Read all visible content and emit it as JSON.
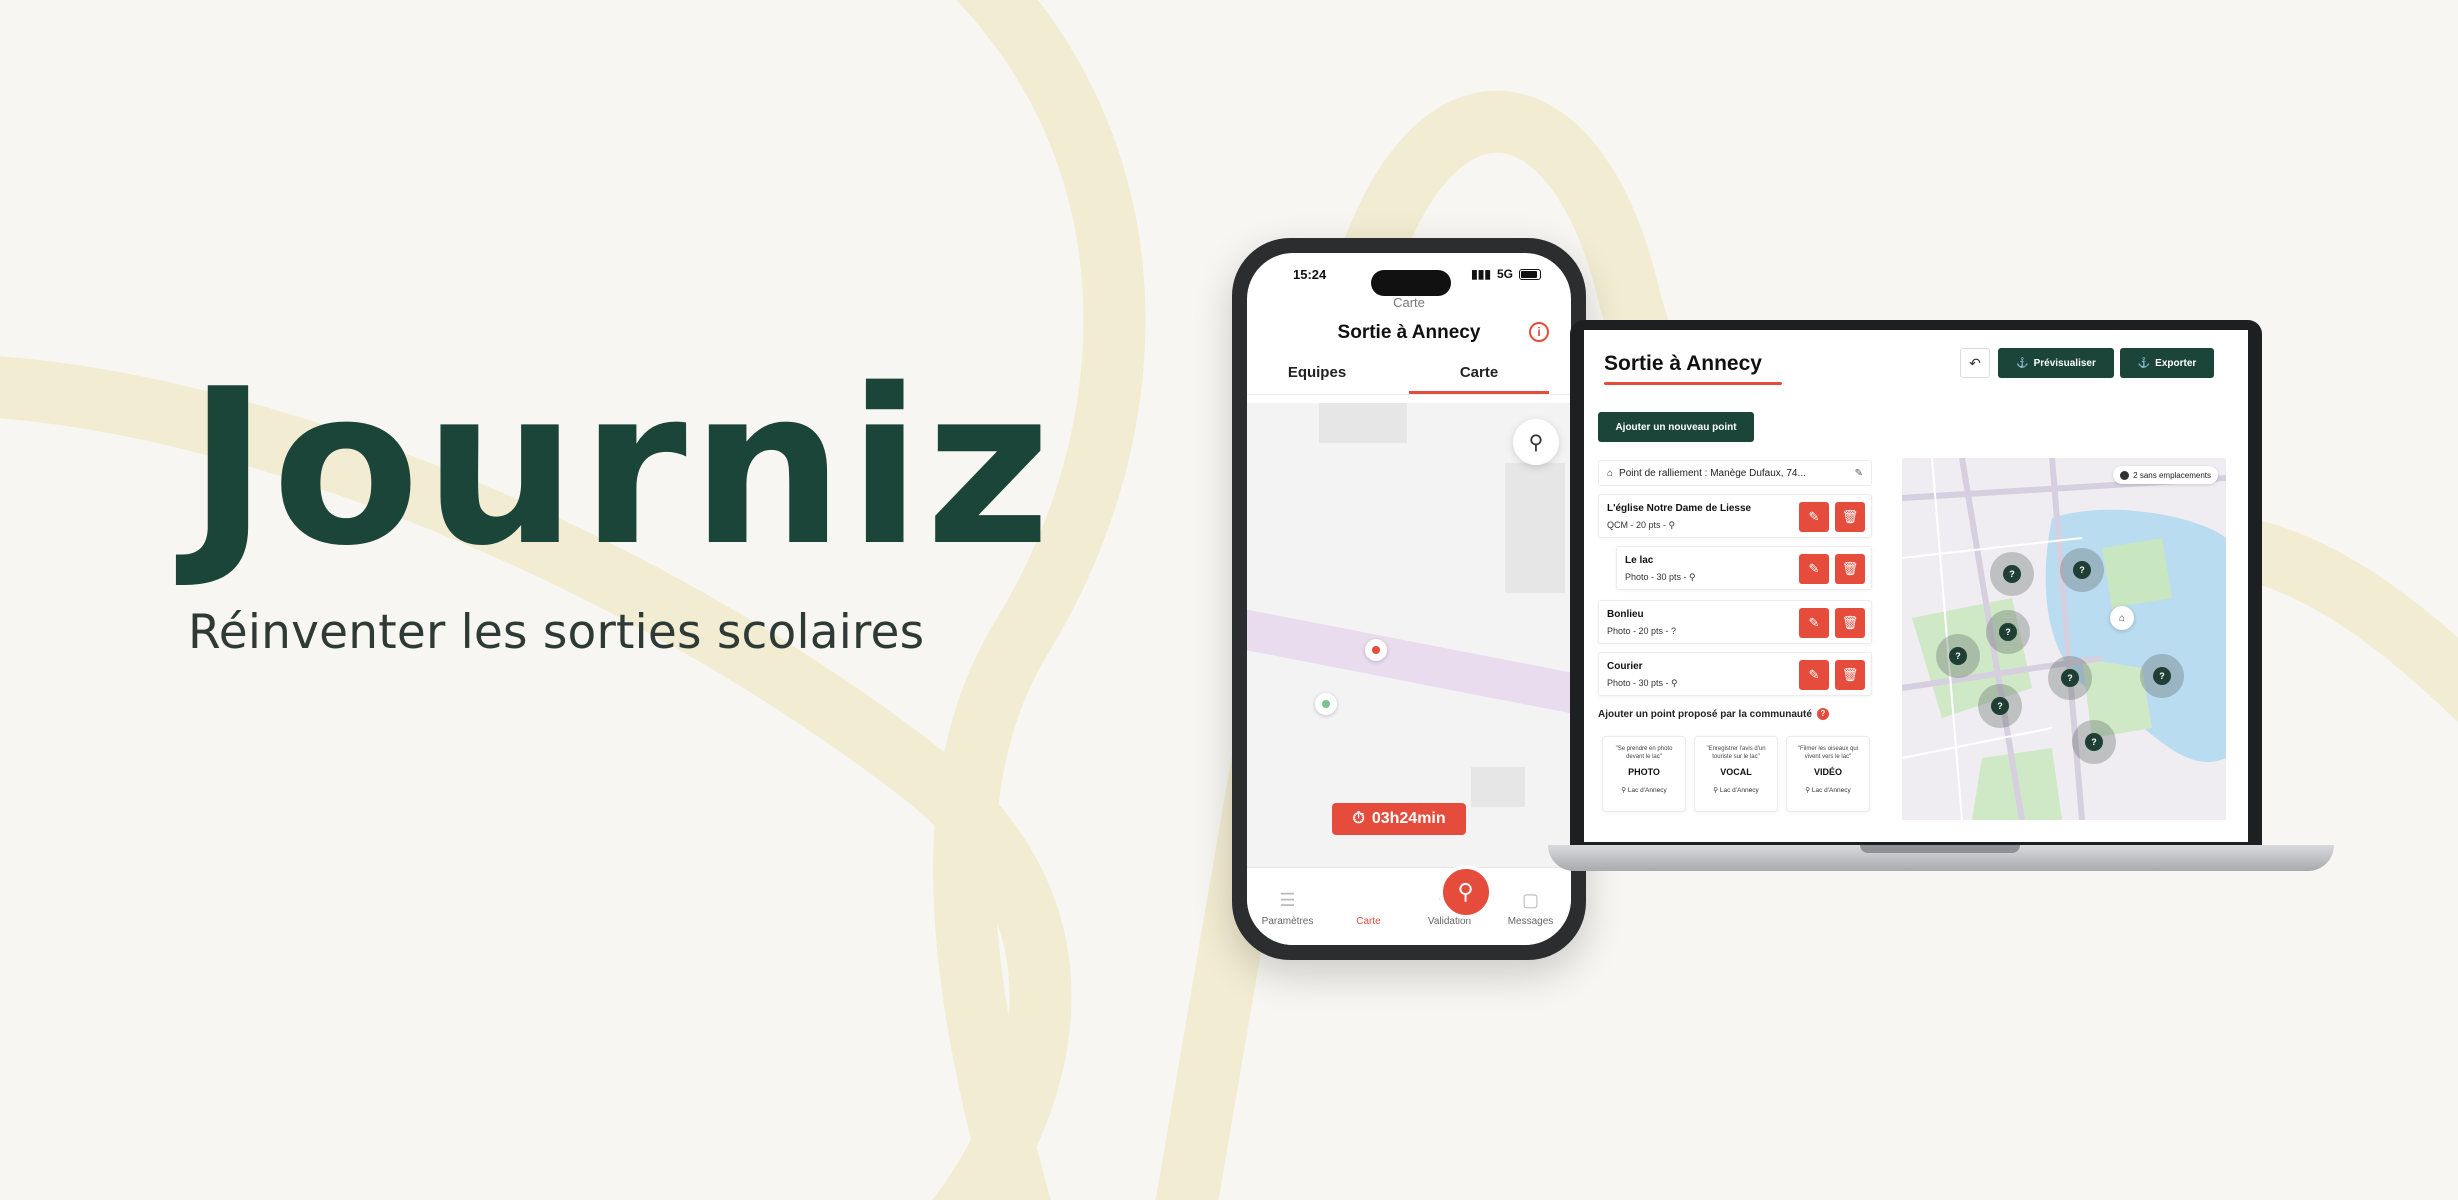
{
  "brand": {
    "logo": "Journiz",
    "tagline": "Réinventer les sorties scolaires"
  },
  "colors": {
    "brand_green": "#1b4538",
    "accent_red": "#e54c3c",
    "ribbon": "#f2ecd2",
    "background": "#f8f6f2"
  },
  "phone": {
    "time": "15:24",
    "network": "5G",
    "header_sub": "Carte",
    "title": "Sortie à Annecy",
    "tabs": [
      {
        "label": "Equipes",
        "active": false
      },
      {
        "label": "Carte",
        "active": true
      }
    ],
    "timer": "03h24min",
    "nav": [
      {
        "label": "Paramètres",
        "icon": "sliders-icon"
      },
      {
        "label": "Carte",
        "icon": "map-pin-icon",
        "active": true
      },
      {
        "label": "Validation",
        "icon": "validation-icon"
      },
      {
        "label": "Messages",
        "icon": "messages-icon"
      }
    ]
  },
  "dashboard": {
    "title": "Sortie à Annecy",
    "preview_label": "Prévisualiser",
    "export_label": "Exporter",
    "add_point_label": "Ajouter un nouveau point",
    "rally_point": "Point de ralliement : Manège Dufaux, 74...",
    "points": [
      {
        "name": "L'église Notre Dame de Liesse",
        "meta": "QCM - 20 pts - ⚲"
      },
      {
        "name": "Le lac",
        "meta": "Photo - 30 pts - ⚲"
      },
      {
        "name": "Bonlieu",
        "meta": "Photo - 20 pts - ?"
      },
      {
        "name": "Courier",
        "meta": "Photo - 30 pts - ⚲"
      }
    ],
    "community_label": "Ajouter un point proposé par la communauté",
    "community_cards": [
      {
        "quote": "\"Se prendre en photo devant le lac\"",
        "type": "PHOTO",
        "location": "Lac d'Annecy"
      },
      {
        "quote": "\"Enregistrer l'avis d'un touriste sur le lac\"",
        "type": "VOCAL",
        "location": "Lac d'Annecy"
      },
      {
        "quote": "\"Filmer les oiseaux qui vivent vers le lac\"",
        "type": "VIDÉO",
        "location": "Lac d'Annecy"
      }
    ],
    "map_chip": "2 sans emplacements",
    "marker_symbol": "?"
  }
}
